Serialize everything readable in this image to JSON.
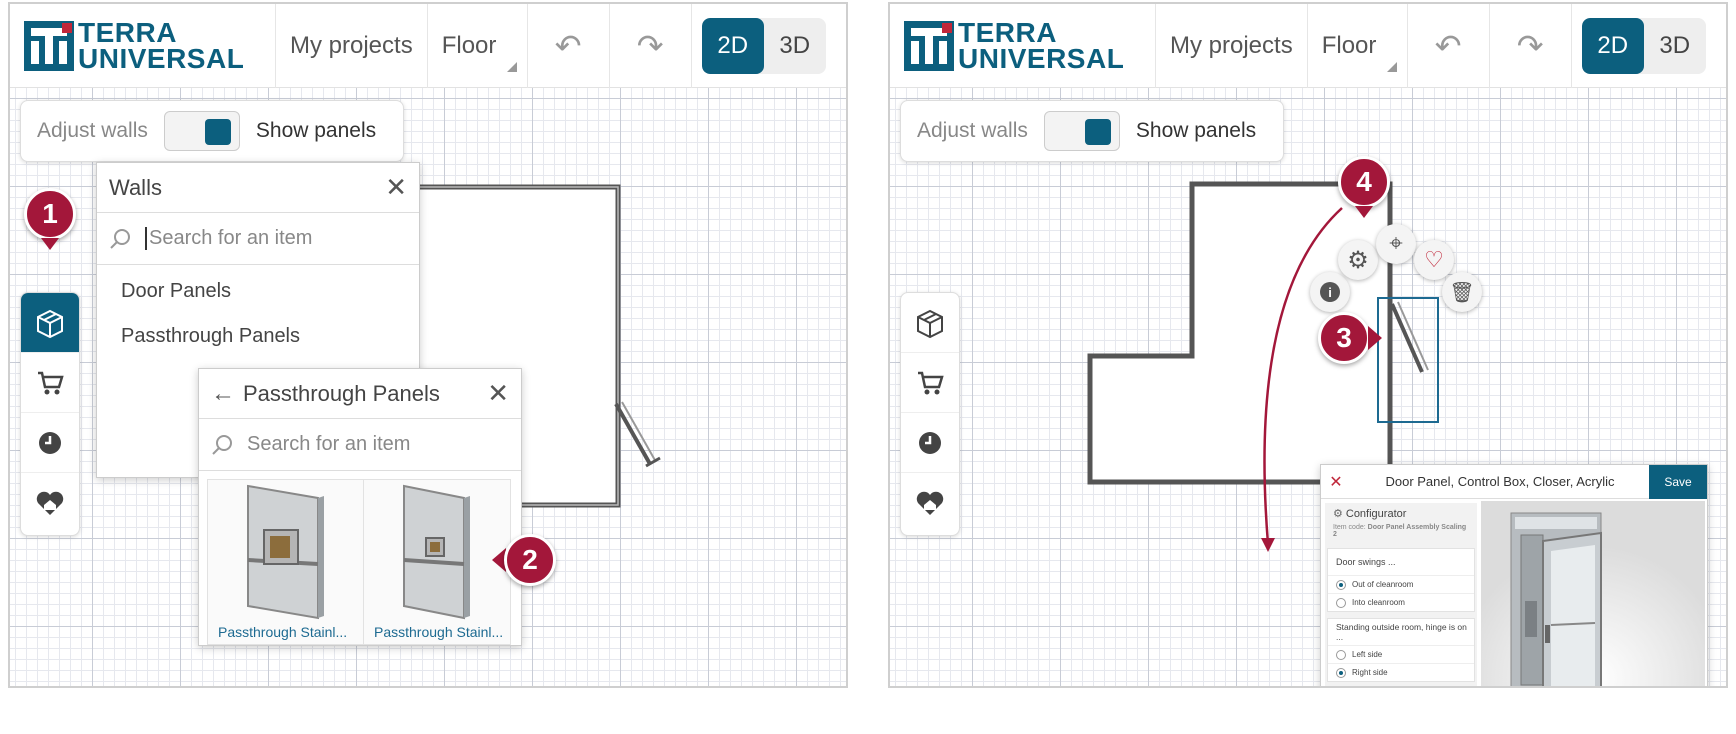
{
  "brand": {
    "line1": "TERRA",
    "line2": "UNIVERSAL",
    "color": "#0c5f7e",
    "accent": "#c0273a"
  },
  "toolbar": {
    "projects": "My projects",
    "floor": "Floor",
    "undo_icon": "undo-icon",
    "redo_icon": "redo-icon",
    "view_2d": "2D",
    "view_3d": "3D"
  },
  "options_bar": {
    "adjust_walls": "Adjust walls",
    "show_panels": "Show panels"
  },
  "sidebar": {
    "items": [
      "catalog-box-icon",
      "cart-icon",
      "history-clock-icon",
      "favorite-home-icon"
    ]
  },
  "markers": [
    "1",
    "2",
    "3",
    "4"
  ],
  "walls_popup": {
    "title": "Walls",
    "search_placeholder": "Search for an item",
    "items": [
      "Door Panels",
      "Passthrough Panels"
    ]
  },
  "passthrough_popup": {
    "title": "Passthrough Panels",
    "search_placeholder": "Search for an item",
    "products": [
      "Passthrough Stainl...",
      "Passthrough Stainl..."
    ]
  },
  "context_actions": [
    "info-icon",
    "gear-icon",
    "locate-icon",
    "heart-icon",
    "trash-icon"
  ],
  "configurator": {
    "title": "Door Panel, Control Box, Closer, Acrylic",
    "save": "Save",
    "section": "Configurator",
    "item_code_label": "Item code:",
    "item_code": "Door Panel Assembly Scaling 2",
    "q1": "Door swings ...",
    "q1_options": [
      "Out of cleanroom",
      "Into cleanroom"
    ],
    "q1_selected": 0,
    "q2": "Standing outside room, hinge is on ...",
    "q2_options": [
      "Left side",
      "Right side"
    ],
    "q2_selected": 1
  }
}
